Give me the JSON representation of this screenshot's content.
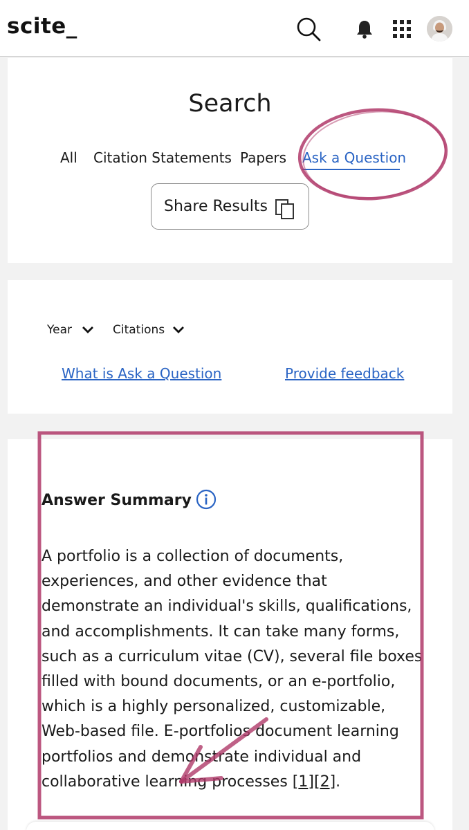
{
  "header": {
    "logo": "scite_",
    "icons": [
      "search-icon",
      "bell-icon",
      "apps-grid-icon",
      "avatar"
    ]
  },
  "search_card": {
    "title": "Search",
    "tabs": [
      {
        "label": "All"
      },
      {
        "label": "Citation Statements"
      },
      {
        "label": "Papers"
      },
      {
        "label": "Ask a Question",
        "active": true
      }
    ],
    "share_label": "Share Results"
  },
  "filters_card": {
    "year_label": "Year",
    "citations_label": "Citations",
    "what_link": "What is Ask a Question",
    "feedback_link": "Provide feedback"
  },
  "answer": {
    "title": "Answer Summary",
    "text": "A portfolio is a collection of documents, experiences, and other evidence that demonstrate an individual's skills, qualifications, and accomplishments. It can take many forms, such as a curriculum vitae (CV), several file boxes filled with bound documents, or an e-portfolio, which is a highly personalized, customizable, Web-based file. E-portfolios document learning portfolios and demonstrate individual and collaborative learning processes ",
    "refs": [
      "1",
      "2"
    ],
    "end": "."
  },
  "colors": {
    "accent": "#2a64c4",
    "annotation": "#b03a6a"
  }
}
